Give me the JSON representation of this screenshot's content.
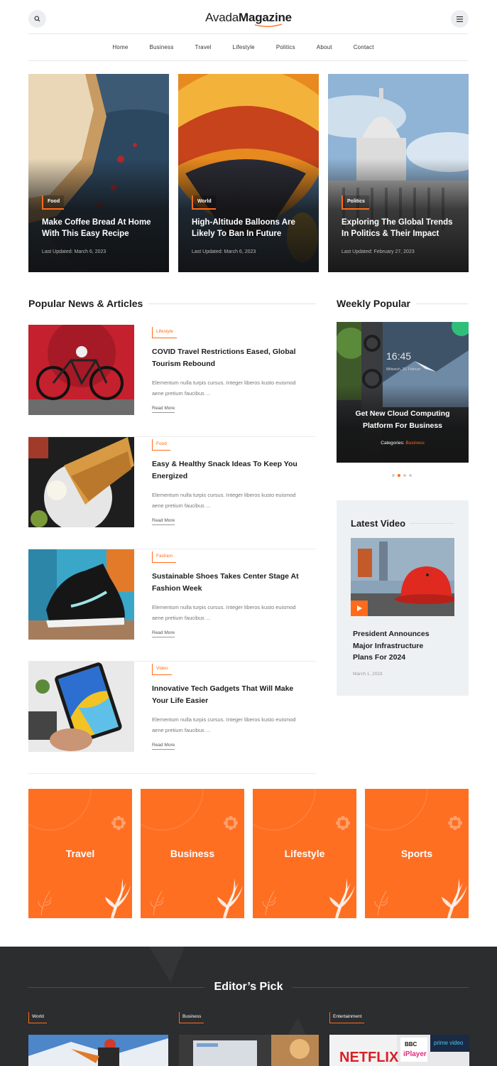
{
  "header": {
    "brand_light": "Avada",
    "brand_bold": "Magazine",
    "search_icon": "search-icon",
    "menu_icon": "hamburger-icon"
  },
  "nav": [
    "Home",
    "Business",
    "Travel",
    "Lifestyle",
    "Politics",
    "About",
    "Contact"
  ],
  "hero": [
    {
      "category": "Food",
      "title": "Make Coffee Bread At Home With This Easy Recipe",
      "date": "Last Updated: March 6, 2023"
    },
    {
      "category": "World",
      "title": "High-Altitude Balloons Are Likely To Ban In Future",
      "date": "Last Updated: March 6, 2023"
    },
    {
      "category": "Politics",
      "title": "Exploring The Global Trends In Politics & Their Impact",
      "date": "Last Updated: February 27, 2023"
    }
  ],
  "popular": {
    "heading": "Popular News & Articles",
    "articles": [
      {
        "category": "Lifestyle",
        "title": "COVID Travel Restrictions Eased, Global Tourism Rebound",
        "excerpt": "Elementum nulla turpis cursus. Integer liberos kusto euismod aene pretium faucibus ...",
        "more": "Read More"
      },
      {
        "category": "Food",
        "title": "Easy & Healthy Snack Ideas To Keep You Energized",
        "excerpt": "Elementum nulla turpis cursus. Integer liberos kusto euismod aene pretium faucibus ...",
        "more": "Read More"
      },
      {
        "category": "Fashion",
        "title": "Sustainable Shoes Takes Center Stage At Fashion Week",
        "excerpt": "Elementum nulla turpis cursus. Integer liberos kusto euismod aene pretium faucibus ...",
        "more": "Read More"
      },
      {
        "category": "Video",
        "title": "Innovative Tech Gadgets That Will Make Your Life Easier",
        "excerpt": "Elementum nulla turpis cursus. Integer liberos kusto euismod aene pretium faucibus ...",
        "more": "Read More"
      }
    ]
  },
  "weekly": {
    "heading": "Weekly Popular",
    "title": "Get New Cloud Computing Platform For Business",
    "categories_label": "Categories:",
    "category": "Business",
    "screen_time": "16:45",
    "screen_date": "Mittwoch, 20. Februar"
  },
  "video": {
    "heading": "Latest Video",
    "title": "President Announces Major Infrastructure Plans For 2024",
    "date": "March 1, 2023",
    "play_icon": "play-icon"
  },
  "tiles": [
    "Travel",
    "Business",
    "Lifestyle",
    "Sports"
  ],
  "editors": {
    "heading": "Editor’s Pick",
    "categories": [
      "World",
      "Business",
      "Entertainment"
    ],
    "logos": {
      "netflix": "NETFLIX",
      "bbc": "BBC",
      "iplayer": "iPlayer",
      "prime": "prime video"
    }
  },
  "colors": {
    "accent": "#ff6b1a",
    "tile": "#ff6f22",
    "dark": "#2b2d2f",
    "video_bg": "#eef1f4"
  }
}
